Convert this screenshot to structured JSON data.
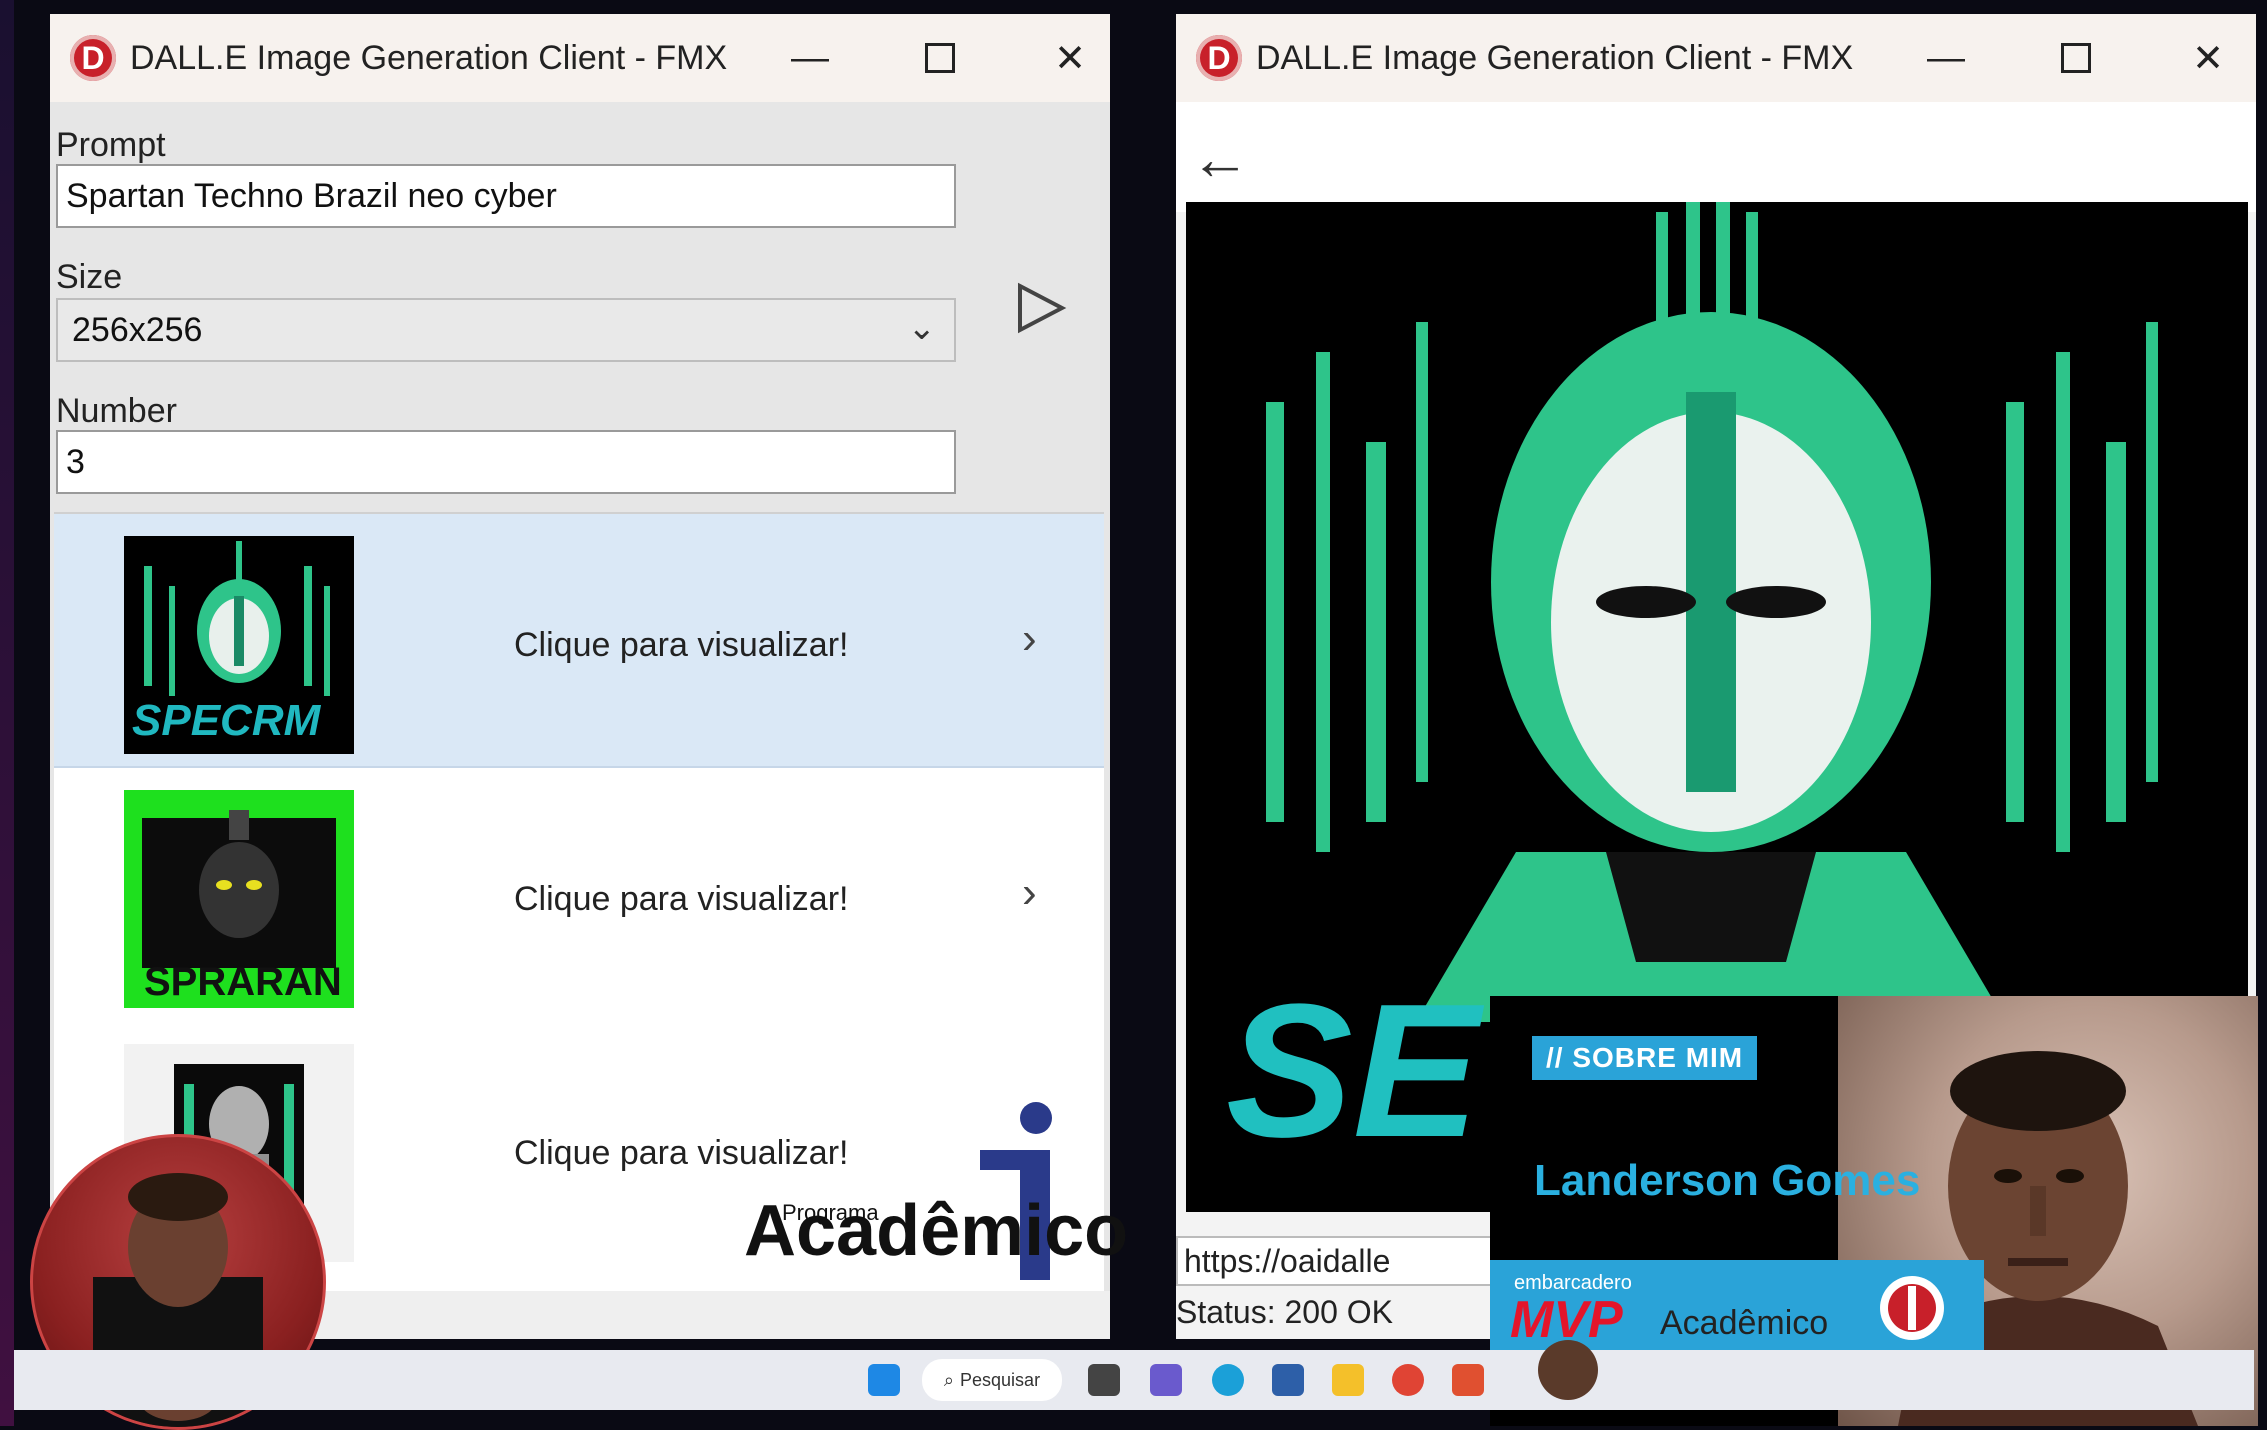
{
  "left_window": {
    "title": "DALL.E Image Generation Client - FMX",
    "logo_letter": "D",
    "prompt_label": "Prompt",
    "prompt_value": "Spartan Techno Brazil neo cyber",
    "size_label": "Size",
    "size_value": "256x256",
    "number_label": "Number",
    "number_value": "3",
    "items": [
      {
        "text": "Clique para visualizar!",
        "thumb_text": "SPECRM"
      },
      {
        "text": "Clique para visualizar!",
        "thumb_text": "SPRARAN"
      },
      {
        "text": "Clique para visualizar!"
      }
    ]
  },
  "right_window": {
    "title": "DALL.E Image Generation Client - FMX",
    "logo_letter": "D",
    "url": "https://oaidalle",
    "status": "Status: 200 OK",
    "image_text": "SE"
  },
  "overlay": {
    "sobre": "// SOBRE MIM",
    "name": "Landerson Gomes",
    "embarcadero": "embarcadero",
    "mvp": "MVP",
    "academico": "Acadêmico",
    "programa": "Programa"
  },
  "taskbar": {
    "search": "Pesquisar"
  },
  "colors": {
    "accent": "#2aa3d8",
    "selection": "#dae8f6",
    "brand_red": "#c8202a",
    "neon_green": "#2ec48a"
  }
}
